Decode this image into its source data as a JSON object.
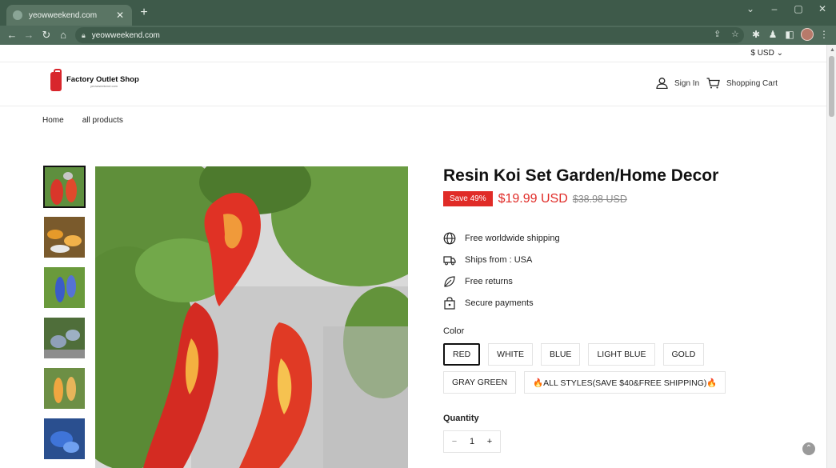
{
  "browser": {
    "tab_title": "yeowweekend.com",
    "url": "yeowweekend.com",
    "tab_close": "✕",
    "new_tab": "+"
  },
  "header": {
    "currency": "$ USD",
    "logo_name": "Factory Outlet Shop",
    "logo_domain": "yeowweekend.com",
    "sign_in": "Sign In",
    "cart": "Shopping Cart"
  },
  "nav": {
    "items": [
      "Home",
      "all products"
    ]
  },
  "product": {
    "title": "Resin Koi Set Garden/Home Decor",
    "save_badge": "Save 49%",
    "price": "$19.99 USD",
    "compare_price": "$38.98 USD",
    "features": [
      {
        "icon": "globe-icon",
        "text": "Free worldwide shipping"
      },
      {
        "icon": "truck-icon",
        "text": "Ships from : USA"
      },
      {
        "icon": "leaf-icon",
        "text": "Free returns"
      },
      {
        "icon": "lock-bag-icon",
        "text": "Secure payments"
      }
    ],
    "color_label": "Color",
    "colors": [
      "RED",
      "WHITE",
      "BLUE",
      "LIGHT BLUE",
      "GOLD",
      "GRAY GREEN",
      "🔥ALL STYLES(SAVE $40&FREE SHIPPING)🔥"
    ],
    "selected_color": "RED",
    "quantity_label": "Quantity",
    "quantity": "1",
    "qty_minus": "−",
    "qty_plus": "+"
  },
  "colors": {
    "accent_red": "#e02b27",
    "browser_frame": "#3e5a4a"
  }
}
